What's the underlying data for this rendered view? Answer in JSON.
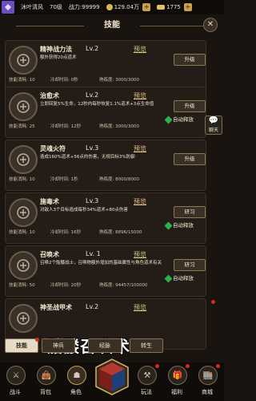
{
  "topbar": {
    "player_name": "沐叶清风",
    "level": "70级",
    "power_label": "战力:",
    "power_value": "99999",
    "coin": "129.04万",
    "ingot": "1775"
  },
  "header": {
    "title": "技能"
  },
  "skills": [
    {
      "name": "精神战力法",
      "level": "Lv.2",
      "preview": "预览",
      "desc": "额外获得20点道术",
      "action": "升级",
      "auto": "",
      "stat1": "技能消耗: 10",
      "stat2": "冷却时间: 0秒",
      "stat3": "熟练度: 3000/3000"
    },
    {
      "name": "治愈术",
      "level": "Lv.2",
      "preview": "预览",
      "desc": "立即回复5%生命，12秒内每秒恢复1.1%道术+3点生命值",
      "action": "升级",
      "auto": "自动释放",
      "stat1": "技能消耗: 25",
      "stat2": "冷却时间: 12秒",
      "stat3": "熟练度: 3000/3000"
    },
    {
      "name": "灵魂火符",
      "level": "Lv.3",
      "preview": "预览",
      "desc": "造成160%道术+56点的伤害，无视目标3%防御",
      "action": "升级",
      "auto": "",
      "stat1": "技能消耗: 10",
      "stat2": "冷却时间: 1秒",
      "stat3": "熟练度: 8000/8000"
    },
    {
      "name": "施毒术",
      "level": "Lv.3",
      "preview": "预览",
      "desc": "对敌人3个目标造成每秒34%道术+80点伤害",
      "action": "研习",
      "auto": "自动释放",
      "stat1": "技能消耗: 10",
      "stat2": "冷却时间: 16秒",
      "stat3": "熟练度: 8896/15000"
    },
    {
      "name": "召唤术",
      "level": "Lv. 1",
      "preview": "预览",
      "desc": "召唤2个骷髅战士，召唤物额外增加的基础属性与角色道术有关",
      "action": "研习",
      "auto": "自动释放",
      "stat1": "技能消耗: 50",
      "stat2": "冷却时间: 20秒",
      "stat3": "熟练度: 94457/100000"
    },
    {
      "name": "神圣战甲术",
      "level": "Lv.2",
      "preview": "预览",
      "desc": "",
      "action": "",
      "auto": "",
      "stat1": "",
      "stat2": "",
      "stat3": ""
    }
  ],
  "overlay": {
    "text": "骷髅召唤术"
  },
  "tabs": [
    "技能",
    "神兵",
    "经脉",
    "转生"
  ],
  "nav": [
    "战斗",
    "背包",
    "角色",
    "",
    "玩法",
    "福利",
    "商城"
  ],
  "chat_label": "聊天",
  "colors": {
    "bg": "#1a1410",
    "card": "#241d17",
    "accent": "#caa050",
    "badge": "#d52a1c"
  }
}
